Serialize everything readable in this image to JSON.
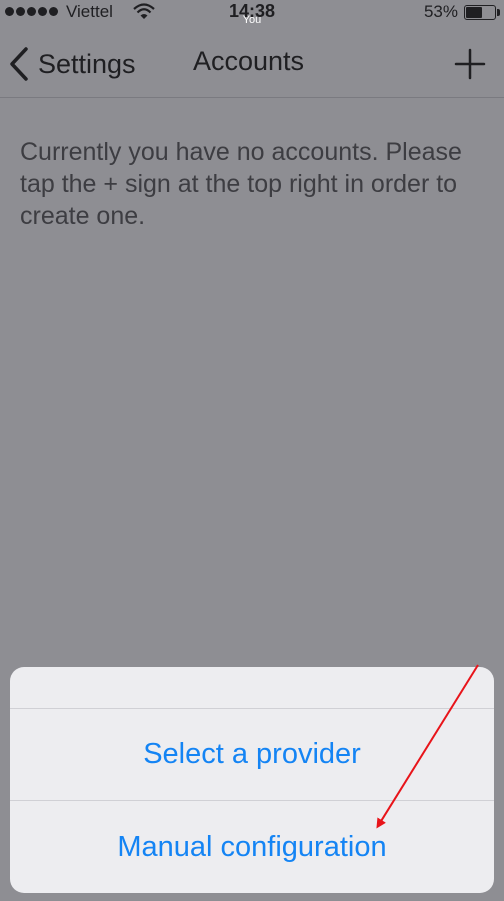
{
  "status_bar": {
    "carrier": "Viettel",
    "time": "14:38",
    "caller_label": "You",
    "battery_percent": "53%",
    "battery_level": 0.53,
    "signal_icon": "signal-dots-icon",
    "wifi_icon": "wifi-icon"
  },
  "nav": {
    "back_label": "Settings",
    "title": "Accounts",
    "back_icon": "chevron-left-icon",
    "add_icon": "plus-icon"
  },
  "empty_message": "Currently you have no accounts. Please tap the + sign at the top right in order to create one.",
  "action_sheet": {
    "options": [
      "Select a provider",
      "Manual configuration"
    ]
  },
  "colors": {
    "background": "#8e8e93",
    "accent": "#1484f4",
    "annotation": "#e8141a"
  }
}
